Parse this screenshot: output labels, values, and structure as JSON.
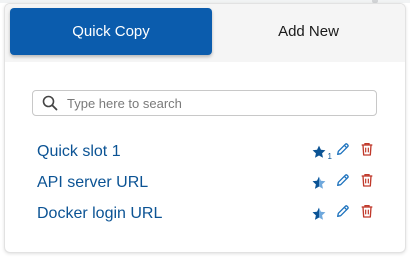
{
  "tabs": [
    {
      "label": "Quick Copy",
      "active": true
    },
    {
      "label": "Add New",
      "active": false
    }
  ],
  "search": {
    "placeholder": "Type here to search",
    "value": "",
    "icon": "search-icon"
  },
  "items": [
    {
      "label": "Quick slot 1",
      "star": "filled",
      "slot": "1"
    },
    {
      "label": "API server URL",
      "star": "half",
      "slot": ""
    },
    {
      "label": "Docker login URL",
      "star": "half",
      "slot": ""
    }
  ],
  "colors": {
    "accent": "#0b5cad",
    "link": "#0b5394",
    "edit": "#1e73be",
    "delete": "#c0392b"
  }
}
